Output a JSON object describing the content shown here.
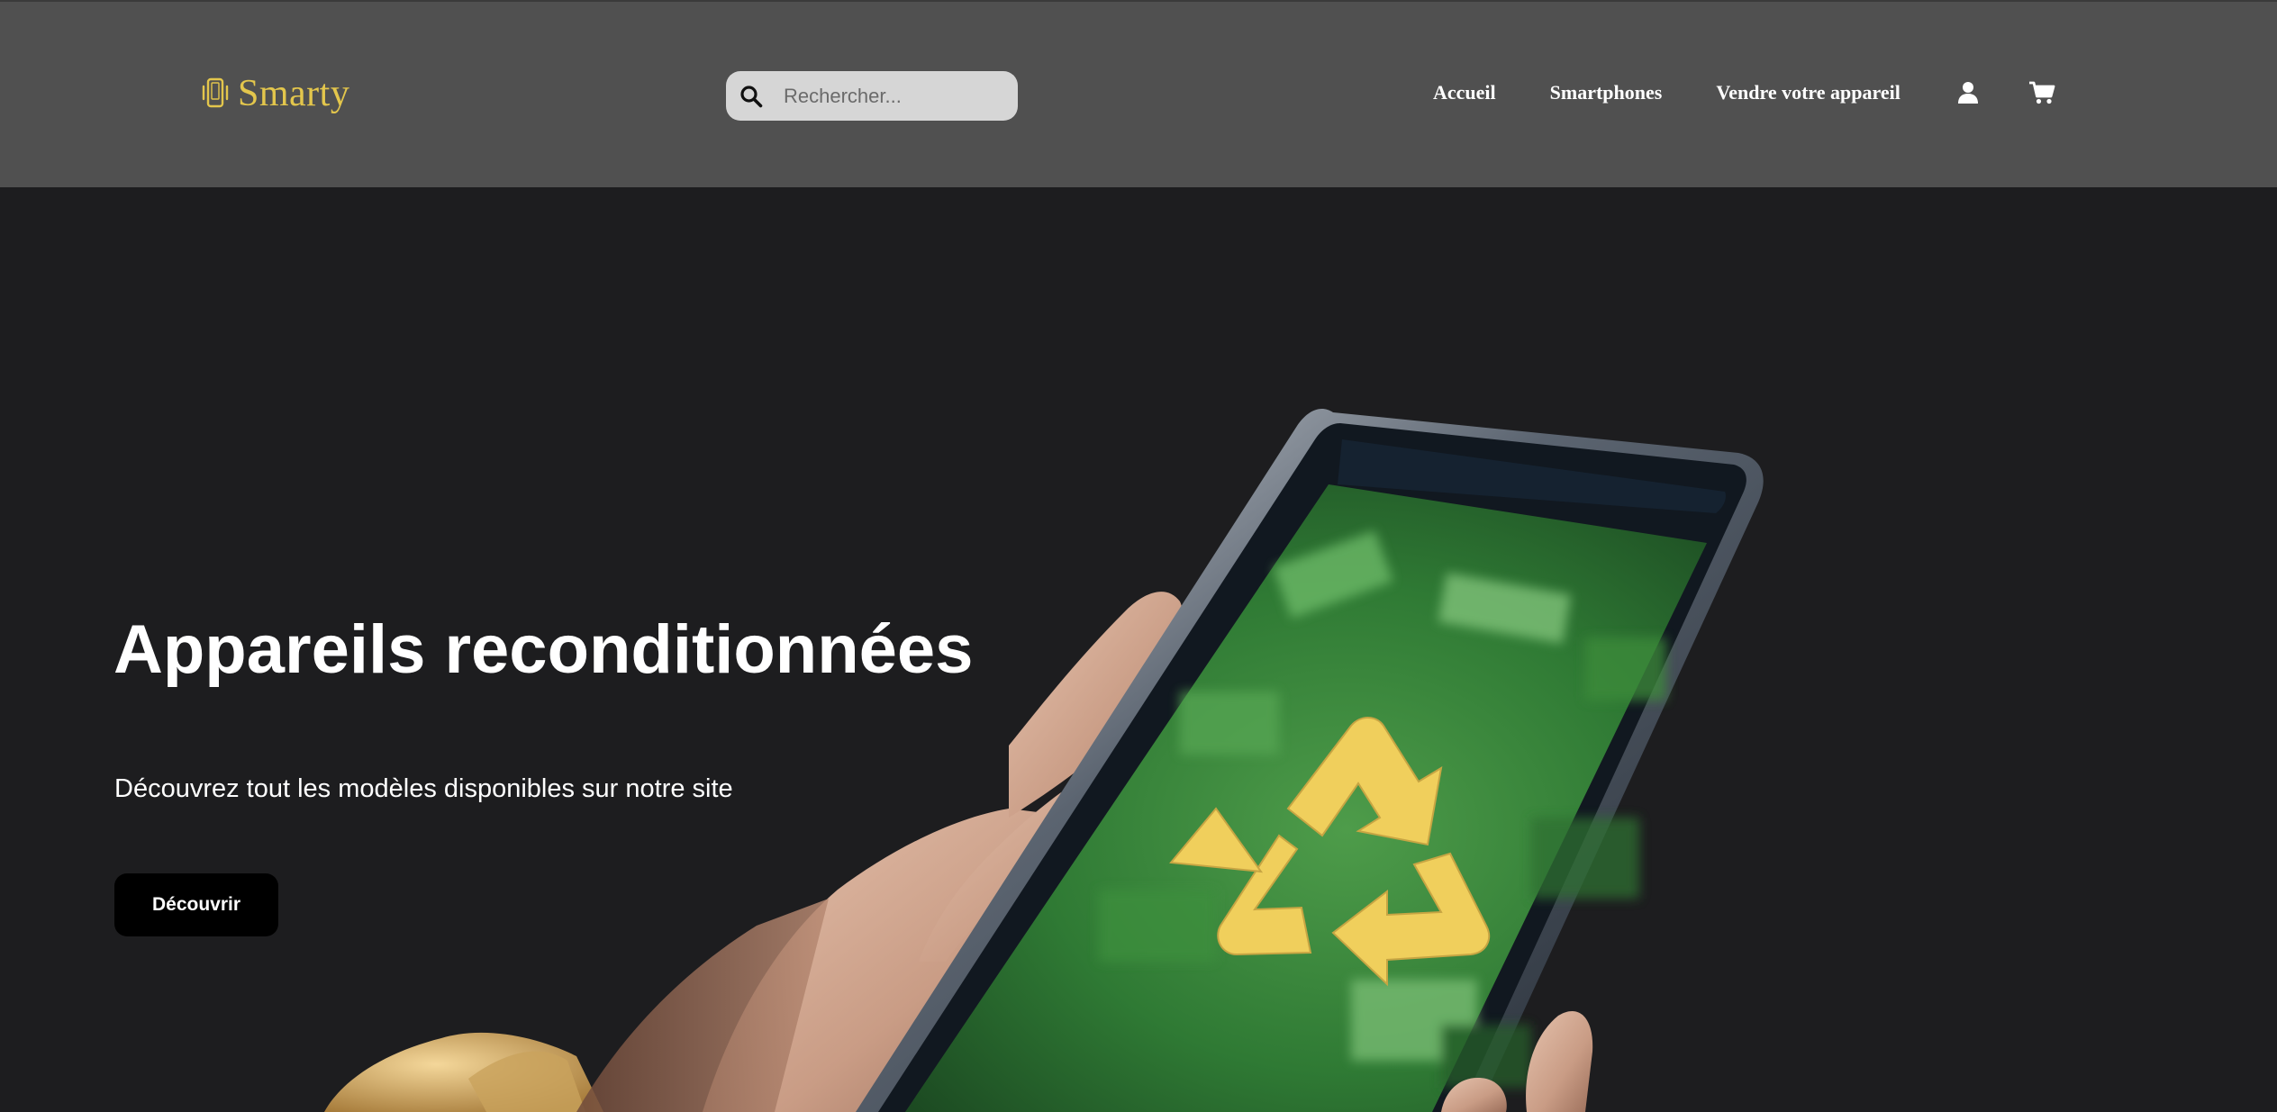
{
  "header": {
    "brand_name": "Smarty",
    "brand_icon": "phone-vibrate-icon",
    "brand_color": "#e3c64c",
    "search": {
      "icon": "search-icon",
      "placeholder": "Rechercher...",
      "value": ""
    },
    "nav": {
      "items": [
        {
          "label": "Accueil"
        },
        {
          "label": "Smartphones"
        },
        {
          "label": "Vendre votre appareil"
        }
      ],
      "account_icon": "user-icon",
      "cart_icon": "cart-icon"
    }
  },
  "hero": {
    "title": "Appareils reconditionnées",
    "subtitle": "Découvrez tout les modèles disponibles sur notre site",
    "cta_label": "Découvrir",
    "image": "hand-holding-phone-recycle-image"
  },
  "colors": {
    "header_bg": "#505050",
    "page_bg": "#1d1d1f",
    "accent": "#e3c64c",
    "button_bg": "#000000",
    "recycle_symbol": "#f0cf5c"
  }
}
